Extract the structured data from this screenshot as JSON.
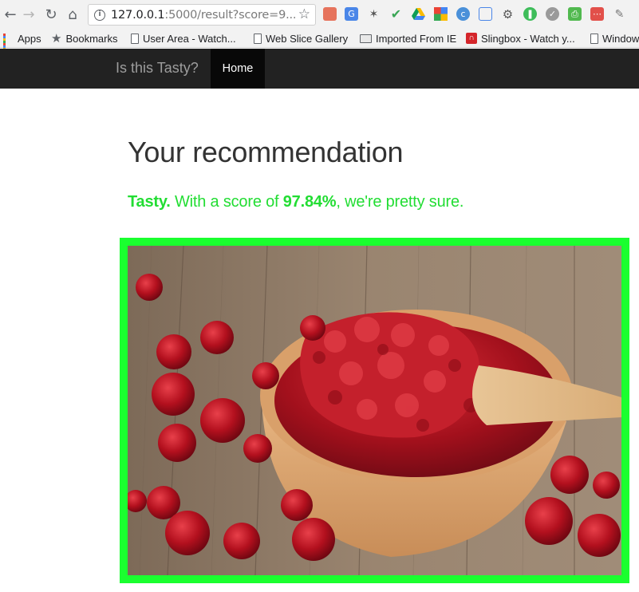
{
  "browser": {
    "url_host": "127.0.0.1",
    "url_rest": ":5000/result?score=9...",
    "bookmarks": [
      {
        "label": "Apps",
        "icon": "apps-grid-icon"
      },
      {
        "label": "Bookmarks",
        "icon": "star-icon"
      },
      {
        "label": "User Area - Watch...",
        "icon": "page-icon"
      },
      {
        "label": "Web Slice Gallery",
        "icon": "page-icon"
      },
      {
        "label": "Imported From IE",
        "icon": "folder-icon"
      },
      {
        "label": "Slingbox - Watch y...",
        "icon": "slingbox-icon"
      },
      {
        "label": "Window",
        "icon": "page-icon"
      }
    ]
  },
  "site": {
    "brand": "Is this Tasty?",
    "nav_home": "Home"
  },
  "result": {
    "title": "Your recommendation",
    "verdict": "Tasty.",
    "text_before_score": "With a score of",
    "score": "97.84%",
    "text_after_score": ", we're pretty sure.",
    "image_subject": "bowl of cranberry sauce with wooden spoon and cranberries",
    "frame_color": "#1aff2f",
    "verdict_color": "#22dd33"
  }
}
